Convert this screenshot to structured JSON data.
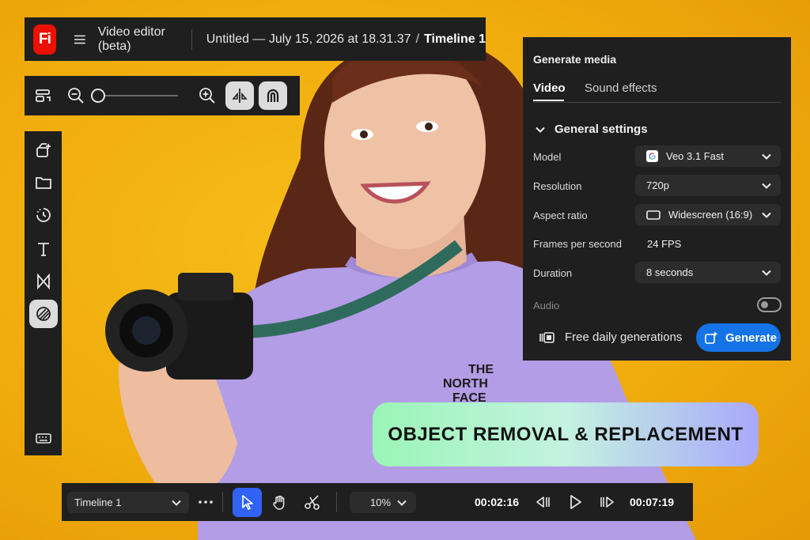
{
  "header": {
    "logo_text": "Fi",
    "app_title": "Video editor (beta)",
    "document_title": "Untitled — July 15, 2026 at 18.31.37",
    "separator": "/",
    "timeline_name": "Timeline 1"
  },
  "zoom_toolbar": {
    "icons": [
      "fit-timeline-icon",
      "zoom-out-icon",
      "zoom-in-icon",
      "snap-icon",
      "magnet-icon"
    ],
    "zoom_level": 0
  },
  "tool_rail": {
    "items": [
      "media-add-icon",
      "folder-icon",
      "history-icon",
      "text-icon",
      "transition-icon",
      "generative-icon",
      "keyboard-icon"
    ],
    "active": "generative-icon"
  },
  "generate_media": {
    "title": "Generate media",
    "tabs": [
      {
        "label": "Video",
        "active": true
      },
      {
        "label": "Sound effects",
        "active": false
      }
    ],
    "section_title": "General settings",
    "settings": {
      "model": {
        "label": "Model",
        "value": "Veo 3.1 Fast"
      },
      "resolution": {
        "label": "Resolution",
        "value": "720p"
      },
      "aspect_ratio": {
        "label": "Aspect ratio",
        "value": "Widescreen (16:9)"
      },
      "fps": {
        "label": "Frames per second",
        "value": "24 FPS"
      },
      "duration": {
        "label": "Duration",
        "value": "8 seconds"
      },
      "audio": {
        "label": "Audio",
        "enabled": false
      }
    },
    "free_label": "Free daily generations",
    "generate_label": "Generate"
  },
  "banner": {
    "text": "OBJECT REMOVAL & REPLACEMENT"
  },
  "timeline_bar": {
    "timeline_select": "Timeline 1",
    "zoom": "10%",
    "current_time": "00:02:16",
    "end_time": "00:07:19"
  },
  "colors": {
    "background": "#f0ac0c",
    "panel": "#1f1f1f",
    "accent_blue": "#1473e6",
    "select_tool_blue": "#3062f5",
    "logo_red": "#eb1000"
  }
}
